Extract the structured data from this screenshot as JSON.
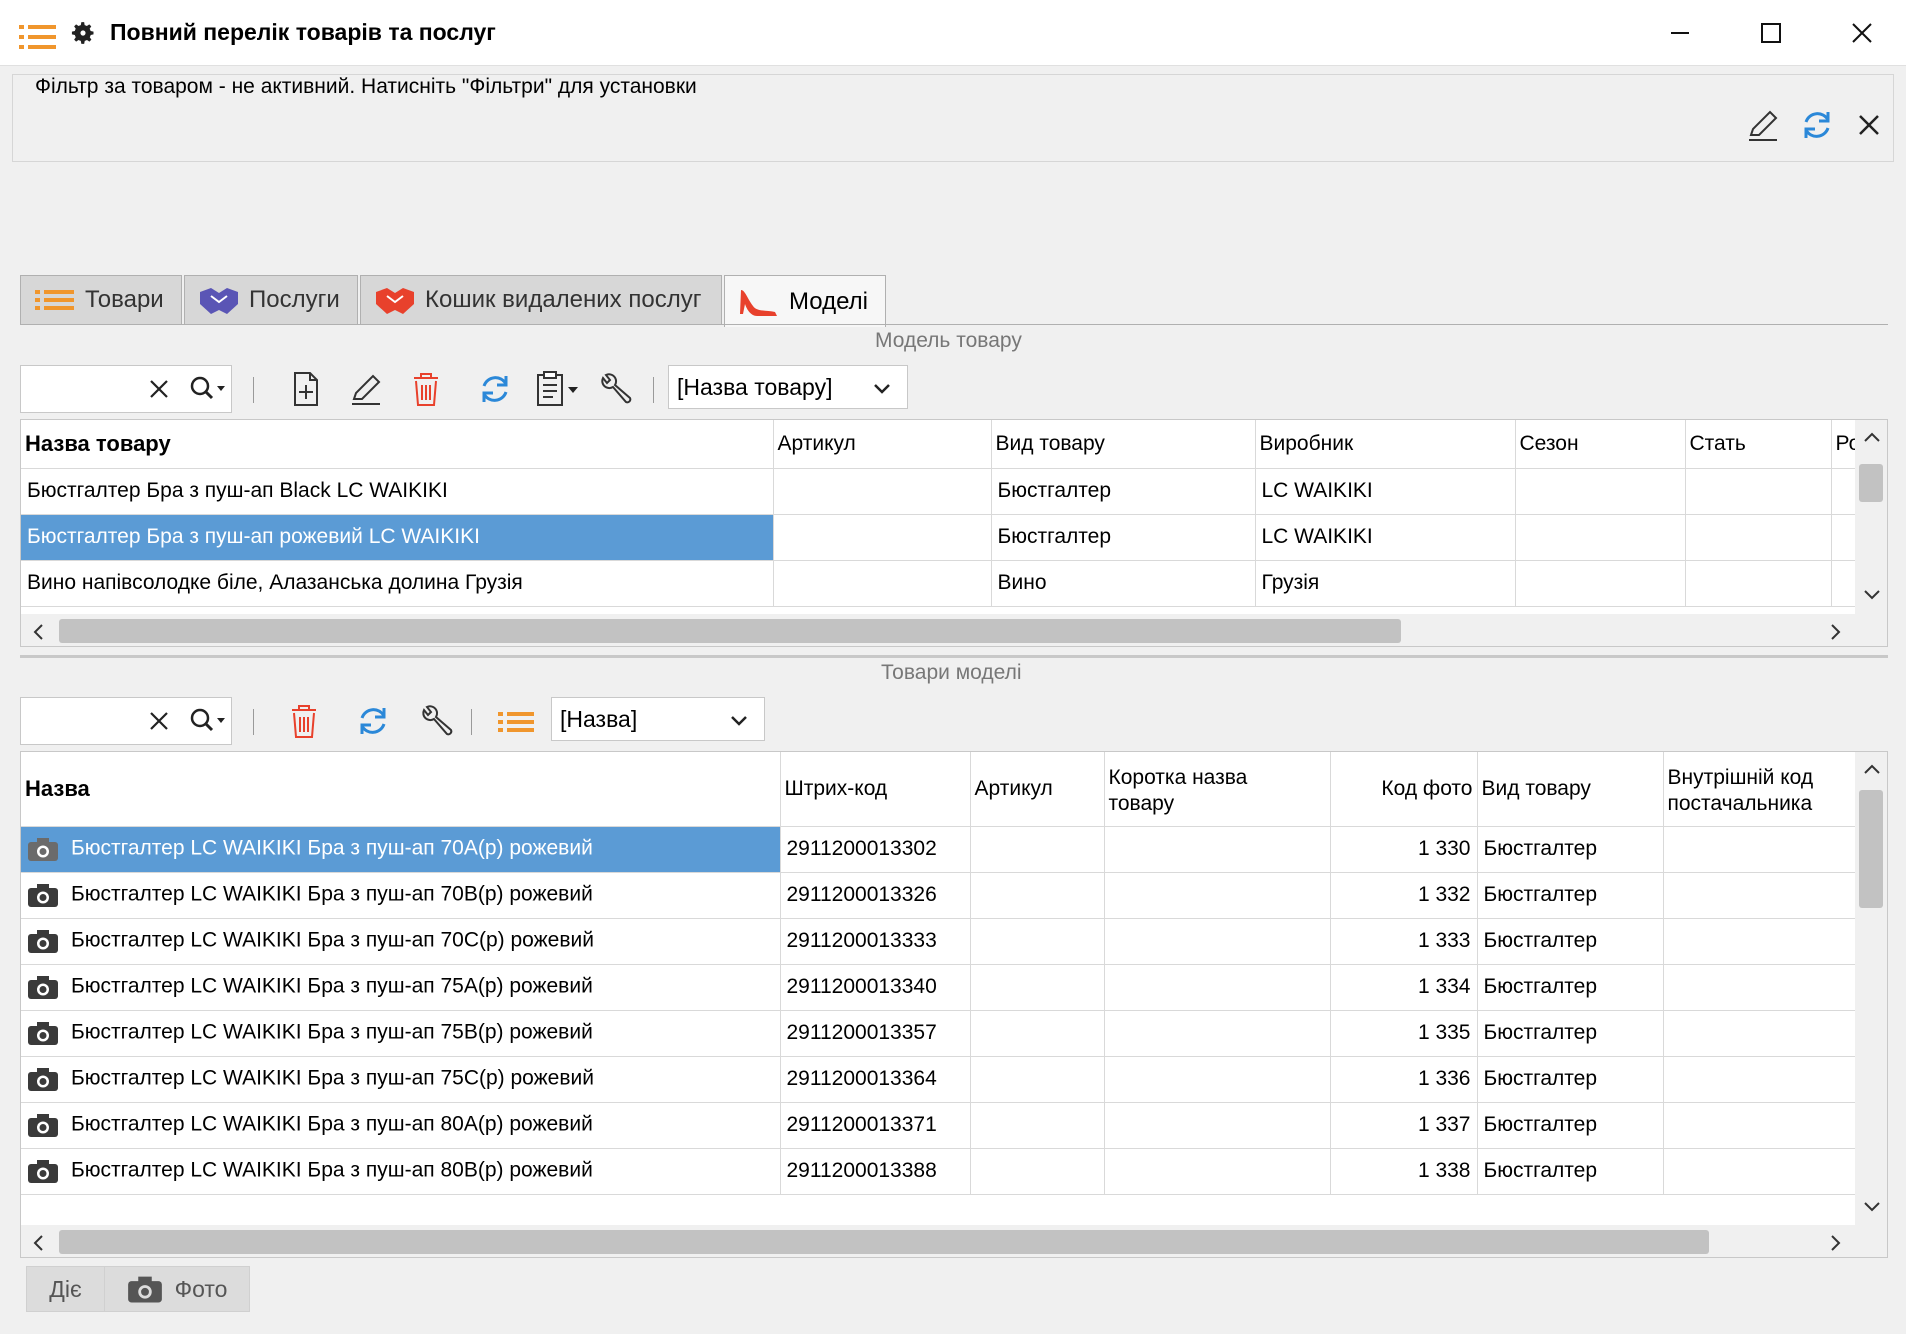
{
  "window": {
    "title": "Повний перелік товарів та послуг"
  },
  "filter": {
    "text": "Фільтр за товаром - не активний. Натисніть \"Фільтри\" для установки"
  },
  "tabs": [
    {
      "label": "Товари",
      "active": false
    },
    {
      "label": "Послуги",
      "active": false
    },
    {
      "label": "Кошик видалених послуг",
      "active": false
    },
    {
      "label": "Моделі",
      "active": true
    }
  ],
  "models_section": {
    "label": "Модель товару",
    "search_value": "",
    "combo_value": "[Назва товару]",
    "columns": [
      "Назва товару",
      "Артикул",
      "Вид товару",
      "Виробник",
      "Сезон",
      "Стать",
      "Ро"
    ],
    "rows": [
      {
        "name": "Бюстгалтер Бра з пуш-ап Black LC WAIKIKI",
        "article": "",
        "kind": "Бюстгалтер",
        "maker": "LC WAIKIKI",
        "season": "",
        "gender": "",
        "extra": ""
      },
      {
        "name": "Бюстгалтер Бра з пуш-ап рожевий LC WAIKIKI",
        "article": "",
        "kind": "Бюстгалтер",
        "maker": "LC WAIKIKI",
        "season": "",
        "gender": "",
        "extra": ""
      },
      {
        "name": "Вино напівсолодке біле, Алазанська долина Грузія",
        "article": "",
        "kind": "Вино",
        "maker": "Грузія",
        "season": "",
        "gender": "",
        "extra": ""
      }
    ]
  },
  "items_section": {
    "label": "Товари моделі",
    "search_value": "",
    "combo_value": "[Назва]",
    "columns": {
      "name": "Назва",
      "barcode": "Штрих-код",
      "article": "Артикул",
      "short_line1": "Коротка назва",
      "short_line2": "товару",
      "photo": "Код фото",
      "kind": "Вид товару",
      "supplier_line1": "Внутрішній код",
      "supplier_line2": "постачальника"
    },
    "rows": [
      {
        "name": "Бюстгалтер LC WAIKIKI Бра з пуш-ап 70A(р) рожевий",
        "barcode": "2911200013302",
        "article": "",
        "short": "",
        "photo": "1 330",
        "kind": "Бюстгалтер",
        "supplier": ""
      },
      {
        "name": "Бюстгалтер LC WAIKIKI Бра з пуш-ап 70B(р) рожевий",
        "barcode": "2911200013326",
        "article": "",
        "short": "",
        "photo": "1 332",
        "kind": "Бюстгалтер",
        "supplier": ""
      },
      {
        "name": "Бюстгалтер LC WAIKIKI Бра з пуш-ап 70C(р) рожевий",
        "barcode": "2911200013333",
        "article": "",
        "short": "",
        "photo": "1 333",
        "kind": "Бюстгалтер",
        "supplier": ""
      },
      {
        "name": "Бюстгалтер LC WAIKIKI Бра з пуш-ап 75A(р) рожевий",
        "barcode": "2911200013340",
        "article": "",
        "short": "",
        "photo": "1 334",
        "kind": "Бюстгалтер",
        "supplier": ""
      },
      {
        "name": "Бюстгалтер LC WAIKIKI Бра з пуш-ап 75B(р) рожевий",
        "barcode": "2911200013357",
        "article": "",
        "short": "",
        "photo": "1 335",
        "kind": "Бюстгалтер",
        "supplier": ""
      },
      {
        "name": "Бюстгалтер LC WAIKIKI Бра з пуш-ап 75C(р) рожевий",
        "barcode": "2911200013364",
        "article": "",
        "short": "",
        "photo": "1 336",
        "kind": "Бюстгалтер",
        "supplier": ""
      },
      {
        "name": "Бюстгалтер LC WAIKIKI Бра з пуш-ап 80A(р) рожевий",
        "barcode": "2911200013371",
        "article": "",
        "short": "",
        "photo": "1 337",
        "kind": "Бюстгалтер",
        "supplier": ""
      },
      {
        "name": "Бюстгалтер LC WAIKIKI Бра з пуш-ап 80B(р) рожевий",
        "barcode": "2911200013388",
        "article": "",
        "short": "",
        "photo": "1 338",
        "kind": "Бюстгалтер",
        "supplier": ""
      }
    ]
  },
  "bottom": {
    "acts_label": "Діє",
    "photo_label": "Фото"
  },
  "colors": {
    "selection": "#5b9bd5",
    "accent_orange": "#f0962d",
    "accent_blue": "#2b88d8",
    "delete_red": "#e8412c"
  }
}
